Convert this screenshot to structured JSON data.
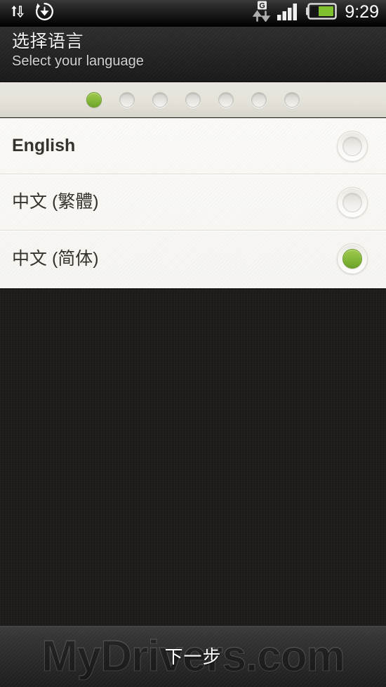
{
  "status_bar": {
    "icons_left": [
      "data-transfer-icon",
      "sync-download-icon"
    ],
    "network_type": "G",
    "icons_right": [
      "gprs-data-arrows-icon",
      "signal-bars-icon",
      "battery-icon"
    ],
    "time": "9:29",
    "battery_color": "#7fc02e",
    "signal_bars": 4,
    "signal_bars_total": 4
  },
  "header": {
    "title": "选择语言",
    "subtitle": "Select your language"
  },
  "steps": {
    "total": 7,
    "current": 1,
    "active_color": "#86b93b",
    "inactive_color": "#e6e5e1"
  },
  "language_list": {
    "items": [
      {
        "label": "English",
        "selected": false,
        "bold": true
      },
      {
        "label": "中文 (繁體)",
        "selected": false,
        "bold": false
      },
      {
        "label": "中文 (简体)",
        "selected": true,
        "bold": false
      }
    ]
  },
  "footer": {
    "next_label": "下一步"
  },
  "watermark": {
    "text": "MyDrivers.com"
  }
}
